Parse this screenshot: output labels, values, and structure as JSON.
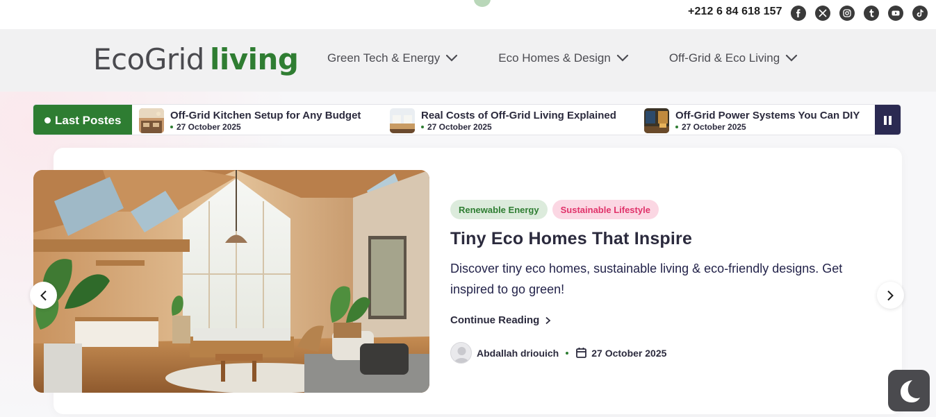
{
  "topbar": {
    "phone": "+212 6 84 618 157",
    "socials": [
      "facebook-icon",
      "x-icon",
      "instagram-icon",
      "tumblr-icon",
      "youtube-icon",
      "tiktok-icon"
    ]
  },
  "header": {
    "logo_part1": "EcoGrid",
    "logo_part2": "living",
    "nav": [
      {
        "label": "Green Tech & Energy"
      },
      {
        "label": "Eco Homes & Design"
      },
      {
        "label": "Off-Grid & Eco Living"
      }
    ]
  },
  "ticker": {
    "label": "Last Postes",
    "items": [
      {
        "title": "Off-Grid Kitchen Setup for Any Budget",
        "date": "27 October 2025"
      },
      {
        "title": "Real Costs of Off-Grid Living Explained",
        "date": "27 October 2025"
      },
      {
        "title": "Off-Grid Power Systems You Can DIY",
        "date": "27 October 2025"
      }
    ]
  },
  "featured": {
    "tags": [
      "Renewable Energy",
      "Sustainable Lifestyle"
    ],
    "title": "Tiny Eco Homes That Inspire",
    "excerpt": "Discover tiny eco homes, sustainable living & eco-friendly designs. Get inspired to go green!",
    "continue_label": "Continue Reading",
    "author": "Abdallah driouich",
    "date": "27 October 2025"
  },
  "colors": {
    "brand_green": "#2e7d32",
    "ticker_pause": "#2b2a52",
    "tag_pink": "#e0326a"
  }
}
